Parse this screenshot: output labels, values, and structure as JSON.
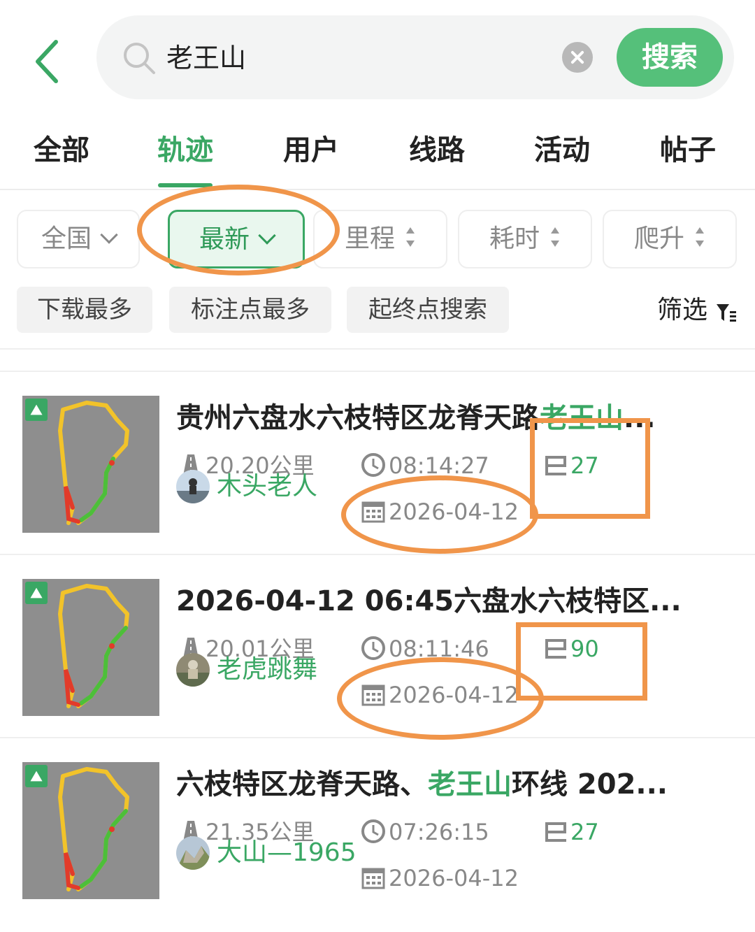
{
  "search": {
    "query": "老王山",
    "button_label": "搜索"
  },
  "tabs": [
    {
      "label": "全部",
      "active": false
    },
    {
      "label": "轨迹",
      "active": true
    },
    {
      "label": "用户",
      "active": false
    },
    {
      "label": "线路",
      "active": false
    },
    {
      "label": "活动",
      "active": false
    },
    {
      "label": "帖子",
      "active": false
    }
  ],
  "sort_chips": {
    "region": "全国",
    "latest": "最新",
    "distance": "里程",
    "duration": "耗时",
    "climb": "爬升"
  },
  "quick_filters": {
    "most_downloaded": "下载最多",
    "most_waypoints": "标注点最多",
    "start_end_search": "起终点搜索",
    "filter_label": "筛选"
  },
  "tracks": [
    {
      "title_prefix": "贵州六盘水六枝特区龙脊天路",
      "title_highlight": "老王山",
      "title_suffix": "...",
      "distance": "20.20公里",
      "duration": "08:14:27",
      "waypoints": "27",
      "author": "木头老人",
      "date": "2026-04-12"
    },
    {
      "title_prefix": "2026-04-12 06:45六盘水六枝特区...",
      "title_highlight": "",
      "title_suffix": "",
      "distance": "20.01公里",
      "duration": "08:11:46",
      "waypoints": "90",
      "author": "老虎跳舞",
      "date": "2026-04-12"
    },
    {
      "title_prefix": "六枝特区龙脊天路、",
      "title_highlight": "老王山",
      "title_suffix": "环线  202...",
      "distance": "21.35公里",
      "duration": "07:26:15",
      "waypoints": "27",
      "author": "大山—1965",
      "date": "2026-04-12"
    }
  ],
  "colors": {
    "accent_green": "#3aa764",
    "search_button": "#55c07a",
    "annotation_orange": "#f0954a"
  },
  "icons": {
    "back": "chevron-left-icon",
    "search": "search-icon",
    "clear": "clear-icon",
    "filter": "filter-icon",
    "distance": "road-icon",
    "duration": "clock-icon",
    "waypoints": "flag-icon",
    "date": "calendar-icon"
  }
}
